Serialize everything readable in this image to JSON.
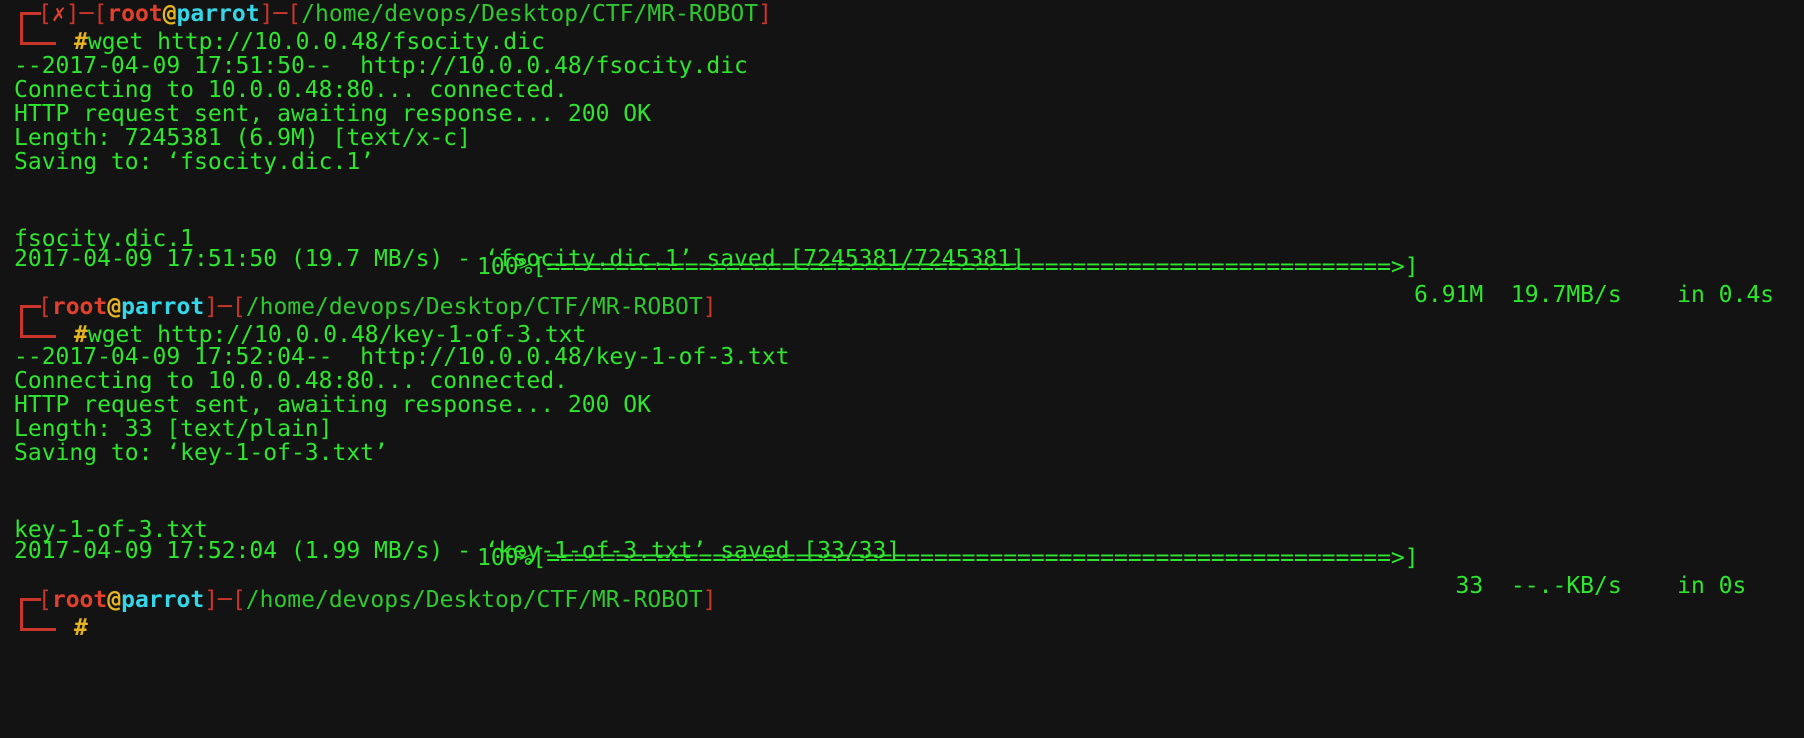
{
  "prompts": [
    {
      "open_bracket": "┌─[",
      "error_mark": "✗",
      "mid_bracket": "]─[",
      "user": "root",
      "at": "@",
      "host": "parrot",
      "sep": "]─[",
      "path": "/home/devops/Desktop/CTF/MR-ROBOT",
      "close": "]",
      "hash": "#",
      "command": "wget http://10.0.0.48/fsocity.dic"
    },
    {
      "open_bracket": "┌─[",
      "user": "root",
      "at": "@",
      "host": "parrot",
      "sep": "]─[",
      "path": "/home/devops/Desktop/CTF/MR-ROBOT",
      "close": "]",
      "hash": "#",
      "command": "wget http://10.0.0.48/key-1-of-3.txt"
    },
    {
      "open_bracket": "┌─[",
      "user": "root",
      "at": "@",
      "host": "parrot",
      "sep": "]─[",
      "path": "/home/devops/Desktop/CTF/MR-ROBOT",
      "close": "]",
      "hash": "#",
      "command": ""
    }
  ],
  "download1": {
    "start": "--2017-04-09 17:51:50--  http://10.0.0.48/fsocity.dic",
    "connecting": "Connecting to 10.0.0.48:80... connected.",
    "request": "HTTP request sent, awaiting response... 200 OK",
    "length": "Length: 7245381 (6.9M) [text/x-c]",
    "saving": "Saving to: ‘fsocity.dic.1’",
    "progress_name": "fsocity.dic.1",
    "progress_bar": "100%[=============================================================>]",
    "progress_stats": "6.91M  19.7MB/s    in 0.4s",
    "saved": "2017-04-09 17:51:50 (19.7 MB/s) - ‘fsocity.dic.1’ saved [7245381/7245381]"
  },
  "download2": {
    "start": "--2017-04-09 17:52:04--  http://10.0.0.48/key-1-of-3.txt",
    "connecting": "Connecting to 10.0.0.48:80... connected.",
    "request": "HTTP request sent, awaiting response... 200 OK",
    "length": "Length: 33 [text/plain]",
    "saving": "Saving to: ‘key-1-of-3.txt’",
    "progress_name": "key-1-of-3.txt",
    "progress_bar": "100%[=============================================================>]",
    "progress_stats": "   33  --.-KB/s    in 0s",
    "saved": "2017-04-09 17:52:04 (1.99 MB/s) - ‘key-1-of-3.txt’ saved [33/33]"
  },
  "colors": {
    "background": "#131313",
    "output_green": "#2ee62e",
    "prompt_red": "#c9352a",
    "host_cyan": "#35d6e8",
    "hash_orange": "#e6b420"
  }
}
